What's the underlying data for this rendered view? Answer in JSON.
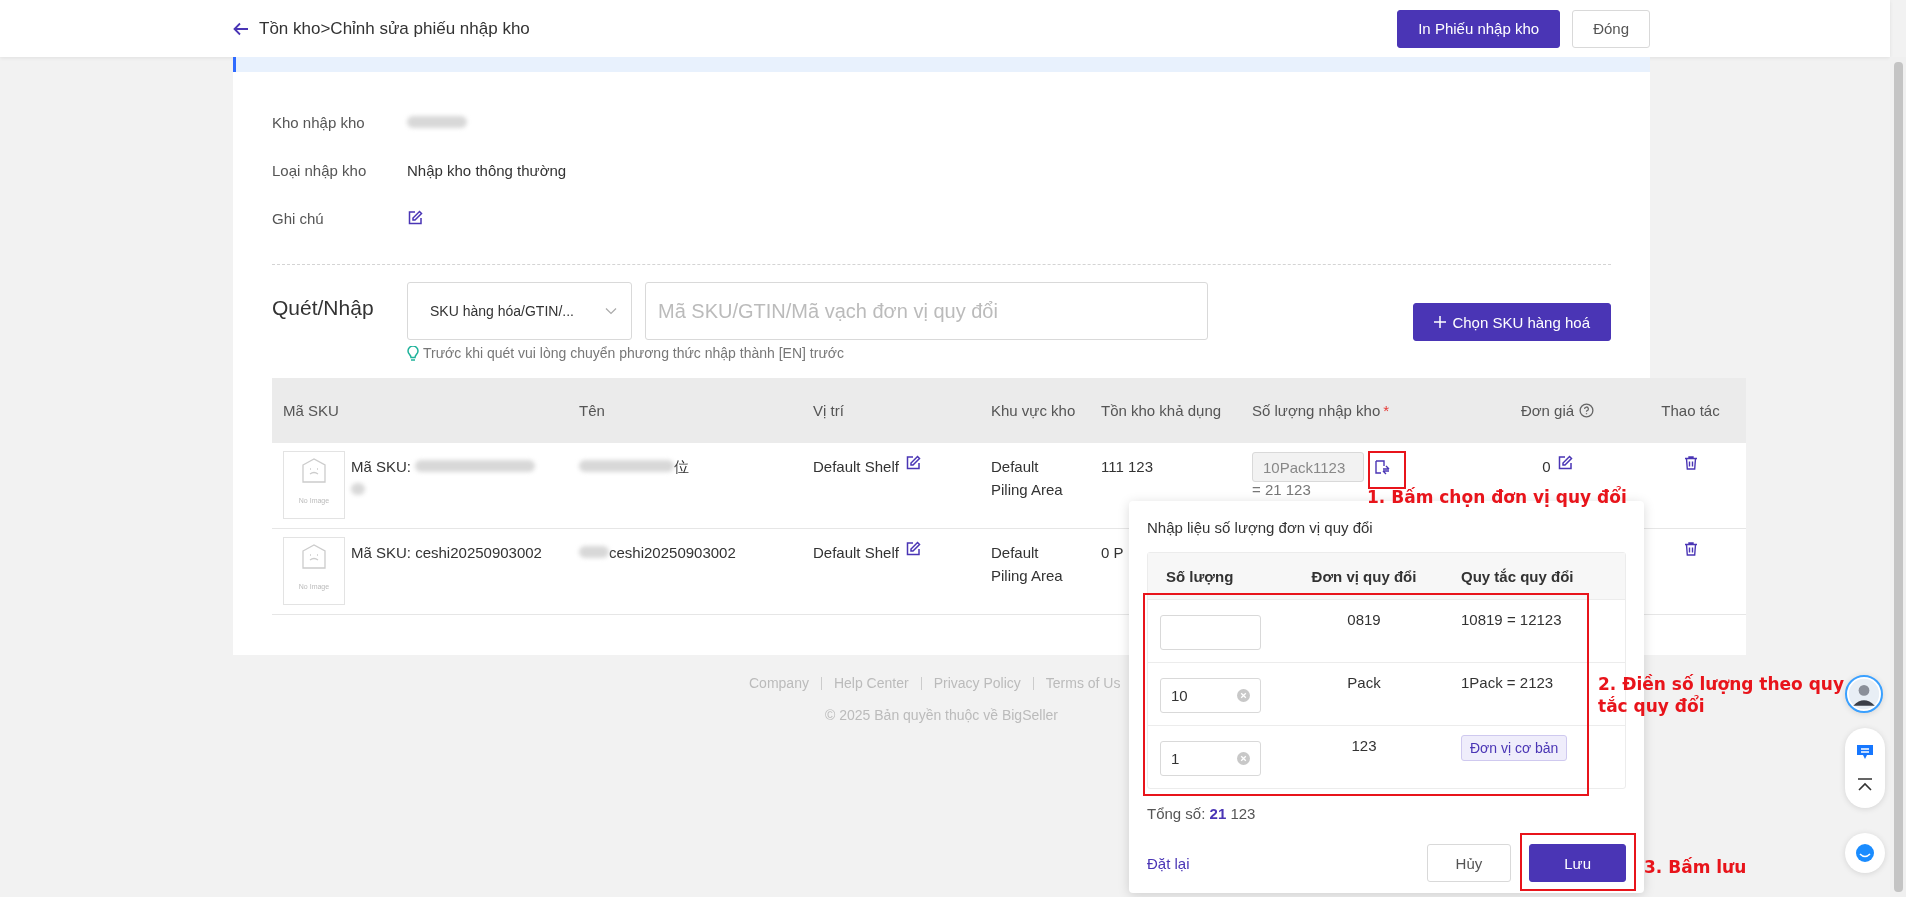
{
  "header": {
    "breadcrumb": "Tồn kho>Chỉnh sửa phiếu nhập kho",
    "buttons": [
      {
        "label": "In Phiếu nhập kho",
        "kind": "primary"
      },
      {
        "label": "Đóng",
        "kind": "default"
      }
    ]
  },
  "form": {
    "fields": [
      {
        "label": "Kho nhập kho",
        "kind": "redacted"
      },
      {
        "label": "Loại nhập kho",
        "kind": "text",
        "value": "Nhập kho thông thường"
      },
      {
        "label": "Ghi chú",
        "kind": "edit"
      }
    ]
  },
  "scan": {
    "label": "Quét/Nhập",
    "mode": "SKU hàng hóa/GTIN/...",
    "placeholder": "Mã SKU/GTIN/Mã vạch đơn vị quy đổi",
    "hint": "Trước khi quét vui lòng chuyển phương thức nhập thành [EN] trước",
    "add_button": "Chọn SKU hàng hoá"
  },
  "table": {
    "columns": [
      {
        "label": "Mã SKU",
        "help": false
      },
      {
        "label": "Tên",
        "help": false
      },
      {
        "label": "Vị trí",
        "help": false
      },
      {
        "label": "Khu vực kho",
        "help": false
      },
      {
        "label": "Tồn kho khả dụng",
        "help": false
      },
      {
        "label": "Số lượng nhập kho",
        "required_mark": "*",
        "help": false
      },
      {
        "label": "Đơn giá",
        "help": true
      },
      {
        "label": "Thao tác",
        "help": false
      }
    ],
    "rows": [
      {
        "image_label": "No Image",
        "sku": "Mã SKU:",
        "sku_redacted": true,
        "name": "位",
        "name_redacted": true,
        "location": "Default Shelf",
        "area": "Default Piling Area",
        "stock": "111 123",
        "quantity": {
          "value": "10Pack1123",
          "disabled": true,
          "total": "= 21 123"
        },
        "price": "0"
      },
      {
        "image_label": "No Image",
        "sku": "Mã SKU: ceshi20250903002",
        "sku_redacted": false,
        "name": "ceshi20250903002",
        "name_redacted": true,
        "location": "Default Shelf",
        "area": "Default Piling Area",
        "stock": "0 P"
      }
    ]
  },
  "footer": {
    "links": [
      "Company",
      "Help Center",
      "Privacy Policy",
      "Terms of Us"
    ],
    "copyright": "© 2025 Bản quyền thuộc về BigSeller"
  },
  "popup": {
    "title": "Nhập liệu số lượng đơn vị quy đổi",
    "columns": [
      "Số lượng",
      "Đơn vị quy đổi",
      "Quy tắc quy đổi"
    ],
    "rows": [
      {
        "unit": "0819",
        "rule": "10819 = 12123",
        "kind": "text",
        "clearable": false
      },
      {
        "value": "10",
        "unit": "Pack",
        "rule": "1Pack = 2123",
        "kind": "text",
        "clearable": true
      },
      {
        "value": "1",
        "unit": "123",
        "rule": "Đơn vị cơ bản",
        "kind": "tag",
        "clearable": true
      }
    ],
    "total": "Tổng số: **21** 123",
    "reset": "Đặt lại",
    "cancel": "Hủy",
    "save": "Lưu"
  },
  "annotations": [
    {
      "text": "1. Bấm chọn đơn vị quy đổi"
    },
    {
      "text": "2. Điền số lượng theo quy tắc quy đổi"
    },
    {
      "text": "3. Bấm lưu"
    }
  ]
}
